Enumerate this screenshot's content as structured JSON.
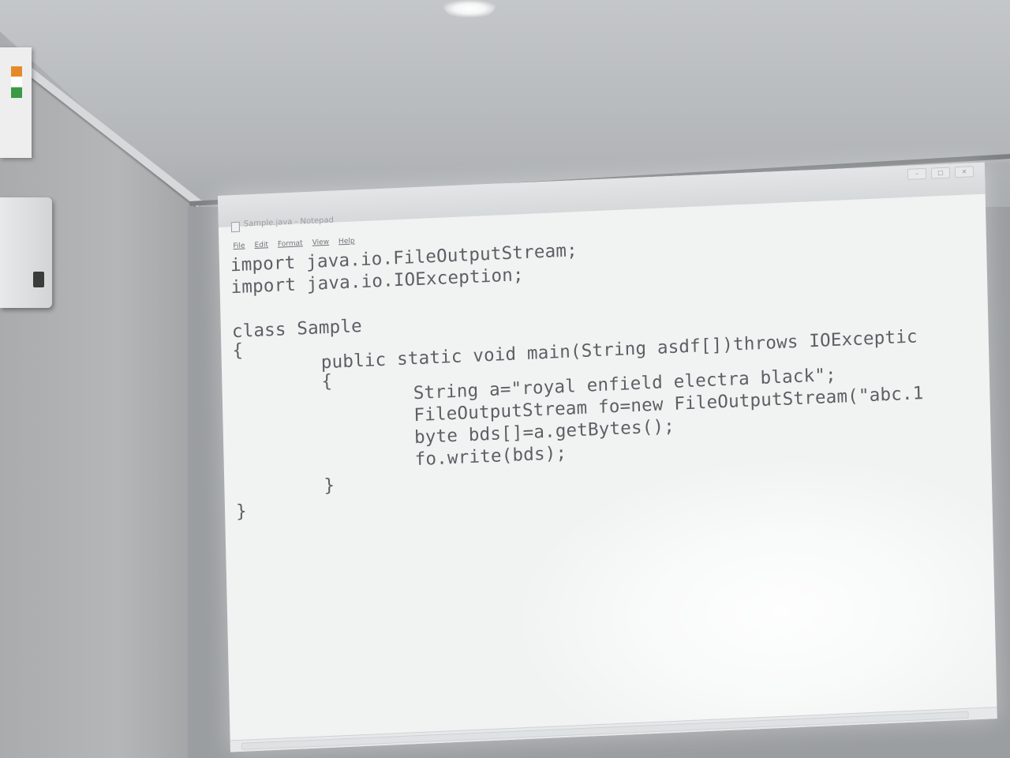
{
  "window": {
    "title": "Sample.java - Notepad",
    "controls": [
      "–",
      "□",
      "×"
    ]
  },
  "menu": {
    "items": [
      "File",
      "Edit",
      "Format",
      "View",
      "Help"
    ]
  },
  "code": {
    "lines": [
      "import java.io.FileOutputStream;",
      "import java.io.IOException;",
      "class Sample",
      "{",
      "public static void main(String asdf[])throws IOExceptic",
      "{",
      "String a=\"royal enfield electra black\";",
      "FileOutputStream fo=new FileOutputStream(\"abc.1",
      "byte bds[]=a.getBytes();",
      "fo.write(bds);",
      "}",
      "}"
    ]
  },
  "colors": {
    "screen_background": "#f1f3f3",
    "code_text": "#5b6063",
    "room": "#a9acae"
  }
}
